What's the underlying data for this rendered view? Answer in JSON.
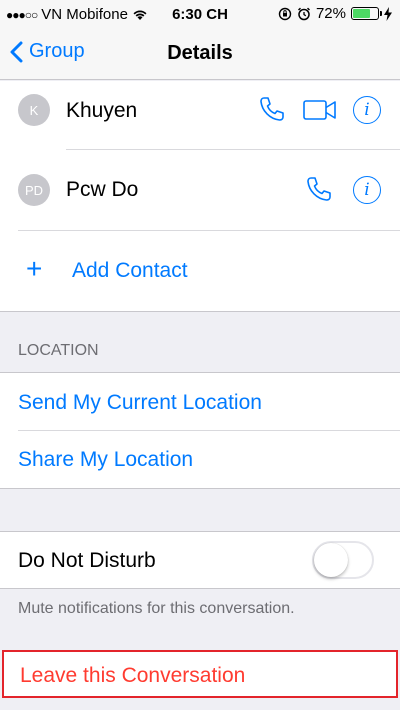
{
  "status_bar": {
    "signal": "●●●○○",
    "carrier": "VN Mobifone",
    "time": "6:30 CH",
    "battery_percent": "72%",
    "battery_level": 0.72
  },
  "nav": {
    "back_label": "Group",
    "title": "Details"
  },
  "contacts": [
    {
      "initials": "K",
      "name": "Khuyen",
      "actions": [
        "phone-icon",
        "video-icon",
        "info-icon"
      ]
    },
    {
      "initials": "PD",
      "name": "Pcw Do",
      "actions": [
        "phone-icon",
        "info-icon"
      ]
    }
  ],
  "add_contact": {
    "plus": "+",
    "label": "Add Contact"
  },
  "location": {
    "header": "LOCATION",
    "send_current": "Send My Current Location",
    "share": "Share My Location"
  },
  "dnd": {
    "label": "Do Not Disturb",
    "enabled": false,
    "note": "Mute notifications for this conversation."
  },
  "leave": {
    "label": "Leave this Conversation"
  },
  "colors": {
    "accent": "#007aff",
    "destructive": "#ff3b30",
    "highlight_border": "#e3242b"
  },
  "info_glyph": "i"
}
